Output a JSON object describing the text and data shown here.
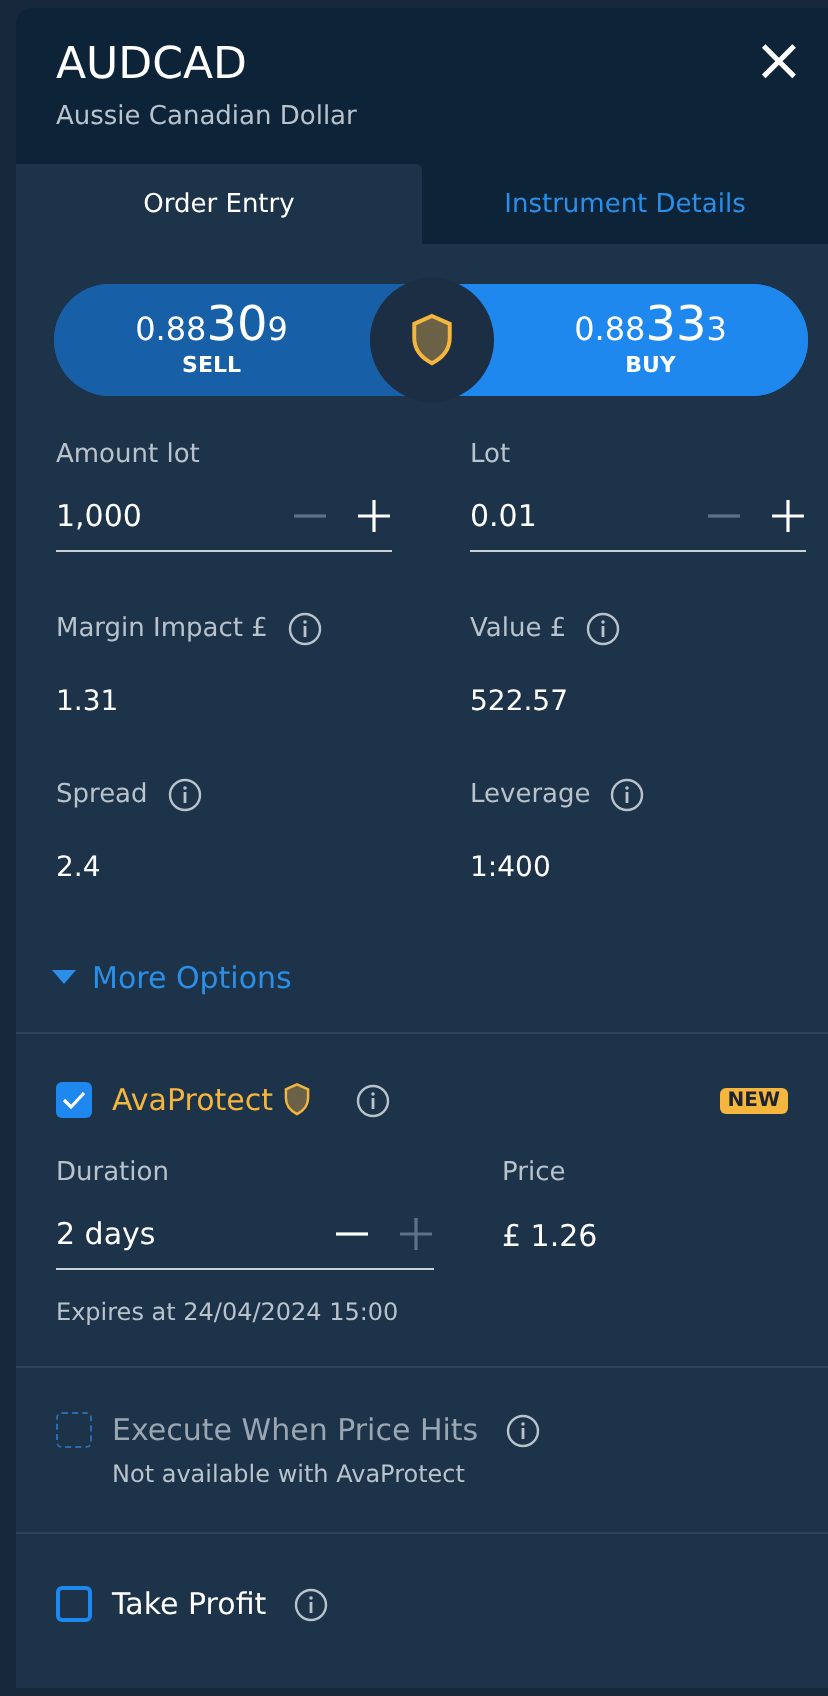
{
  "header": {
    "symbol": "AUDCAD",
    "name": "Aussie Canadian Dollar",
    "close": "×"
  },
  "tabs": [
    {
      "label": "Order Entry",
      "selected": true
    },
    {
      "label": "Instrument Details",
      "selected": false
    }
  ],
  "prices": [
    {
      "kind": "sell",
      "big_prefix": "0.88",
      "pips": "30",
      "fraction": "9",
      "label": "SELL"
    },
    {
      "kind": "buy",
      "big_prefix": "0.88",
      "pips": "33",
      "fraction": "3",
      "label": "BUY"
    }
  ],
  "steppers": [
    {
      "label": "Amount lot",
      "value": "1,000",
      "minus_disabled": true,
      "plus_disabled": false
    },
    {
      "label": "Lot",
      "value": "0.01",
      "minus_disabled": true,
      "plus_disabled": false
    }
  ],
  "stats": [
    {
      "label": "Margin Impact £",
      "value": "1.31"
    },
    {
      "label": "Value £",
      "value": "522.57"
    },
    {
      "label": "Spread",
      "value": "2.4"
    },
    {
      "label": "Leverage",
      "value": "1:400"
    }
  ],
  "more_options": {
    "label": "More Options",
    "expanded": false
  },
  "ava_protect": {
    "label": "AvaProtect",
    "checked": true,
    "badge": "NEW",
    "duration": {
      "label": "Duration",
      "value": "2 days",
      "minus_disabled": false,
      "plus_disabled": true
    },
    "price": {
      "label": "Price",
      "value": "£ 1.26"
    },
    "expires": "Expires at 24/04/2024 15:00"
  },
  "options": [
    {
      "label": "Execute When Price Hits",
      "note": "Not available with AvaProtect",
      "checked": false,
      "disabled": true
    },
    {
      "label": "Take Profit",
      "checked": false,
      "disabled": false
    }
  ]
}
